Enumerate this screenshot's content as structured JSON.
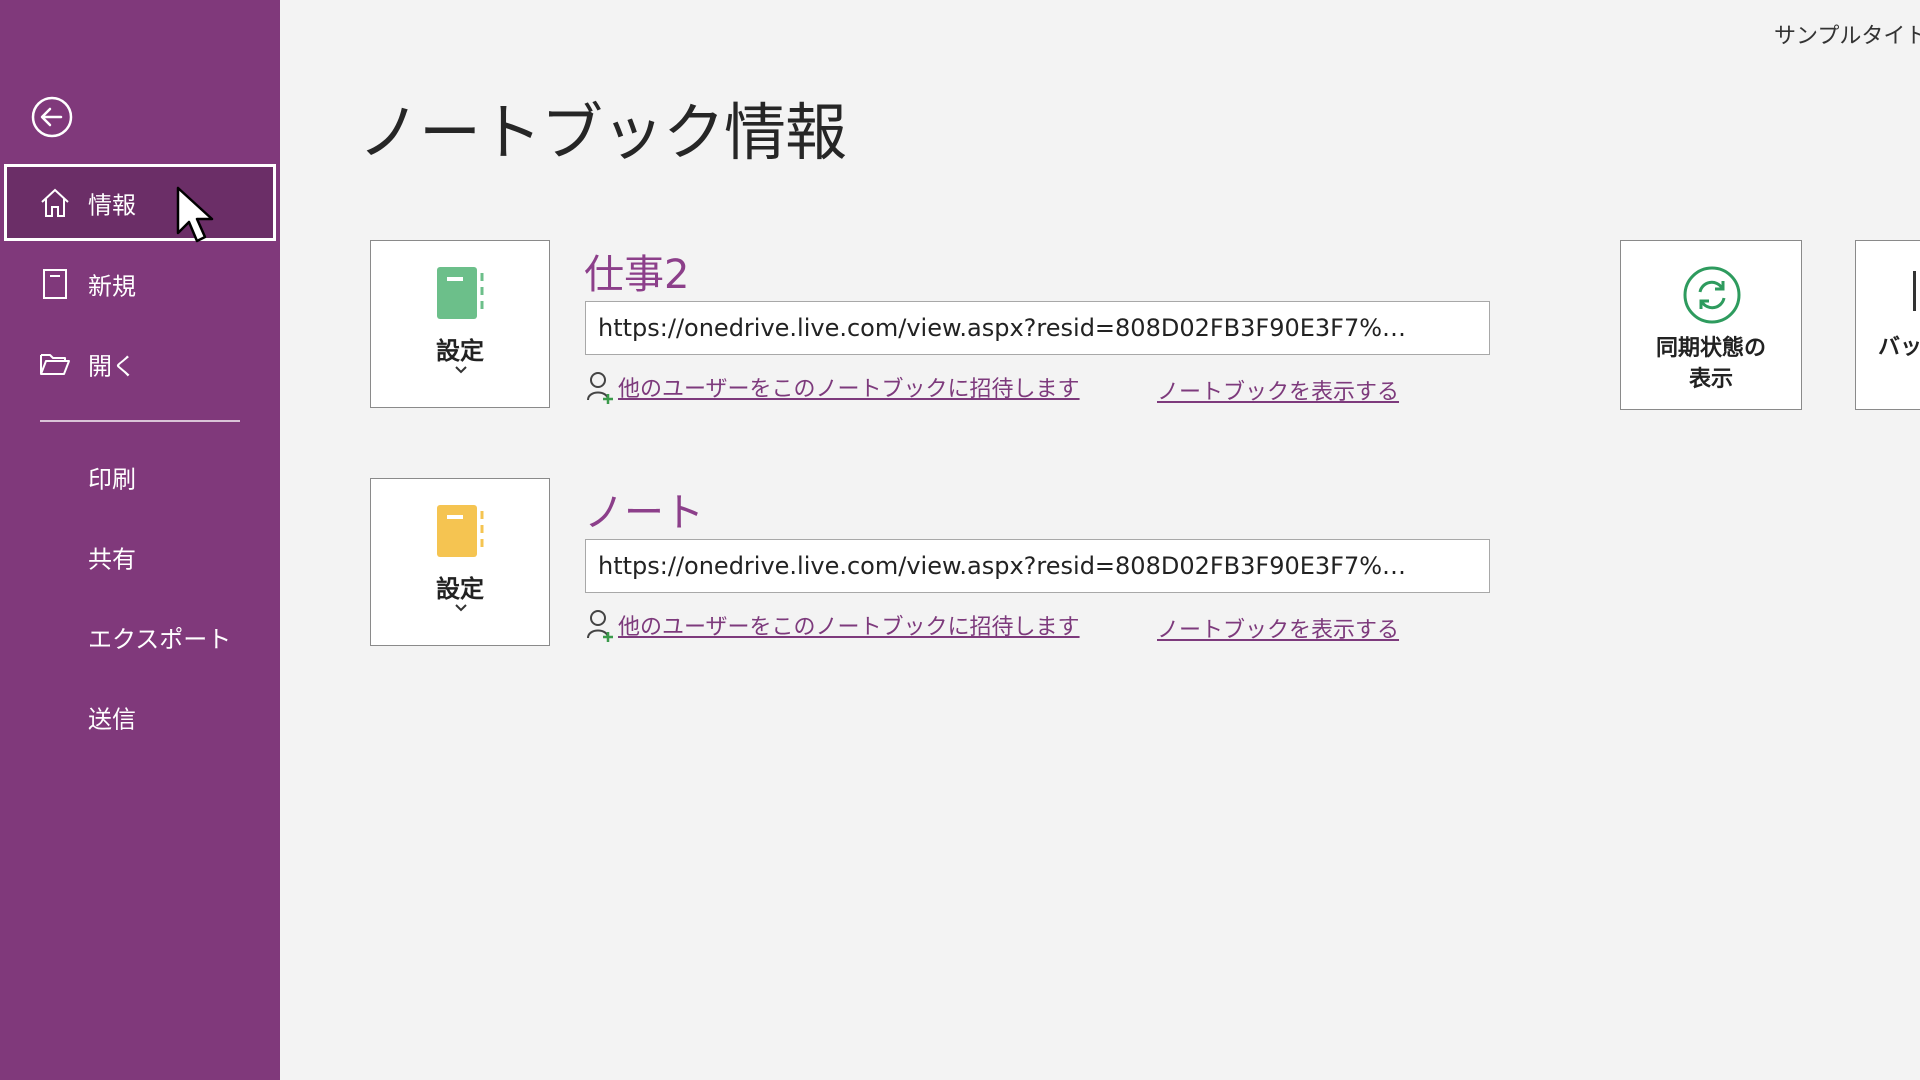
{
  "window": {
    "doc_title": "サンプルタイトル"
  },
  "page": {
    "title": "ノートブック情報"
  },
  "sidebar": {
    "back_icon": "back-arrow-icon",
    "items": [
      {
        "label": "情報",
        "icon": "home-icon",
        "active": true
      },
      {
        "label": "新規",
        "icon": "new-page-icon"
      },
      {
        "label": "開く",
        "icon": "folder-open-icon"
      },
      {
        "label": "印刷"
      },
      {
        "label": "共有"
      },
      {
        "label": "エクスポート"
      },
      {
        "label": "送信"
      }
    ],
    "colors": {
      "bg": "#80397b",
      "active": "#6b2e67"
    }
  },
  "notebooks": [
    {
      "name": "仕事2",
      "settings_label": "設定",
      "icon_color": "#5fba7d",
      "url": "https://onedrive.live.com/view.aspx?resid=808D02FB3F90E3F7%…",
      "invite_label": "他のユーザーをこのノートブックに招待します",
      "open_label": "ノートブックを表示する"
    },
    {
      "name": "ノート",
      "settings_label": "設定",
      "icon_color": "#f2c14e",
      "url": "https://onedrive.live.com/view.aspx?resid=808D02FB3F90E3F7%…",
      "invite_label": "他のユーザーをこのノートブックに招待します",
      "open_label": "ノートブックを表示する"
    }
  ],
  "tiles": {
    "sync": {
      "label_line1": "同期状態の",
      "label_line2": "表示",
      "icon": "sync-icon"
    },
    "backup": {
      "label": "バッ"
    }
  },
  "accent": "#8c3f8a"
}
